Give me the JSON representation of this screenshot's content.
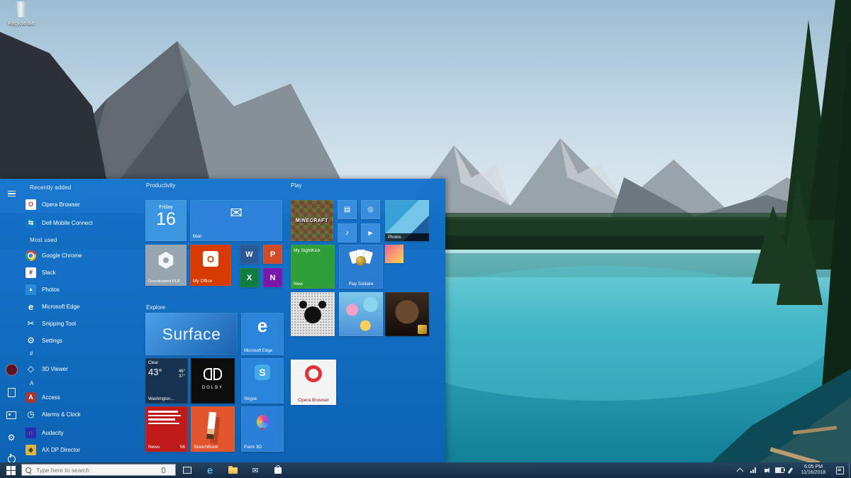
{
  "desktop": {
    "recycle_bin_label": "Recycle Bin"
  },
  "colors": {
    "accent": "#1373cc",
    "taskbar": "#1b3654",
    "lake": "#1d93a8",
    "news_red": "#c01b1b",
    "office_orange": "#d83b01"
  },
  "icons": {
    "opera": "O",
    "dell": "⇆",
    "slack": "#",
    "photos": "▲",
    "edge": "e",
    "snipping": "✂",
    "settings": "⚙",
    "viewer3d": "◇",
    "access": "A",
    "alarms": "◷",
    "audacity": "∩",
    "axdp": "◈",
    "store": "▤",
    "camera": "◎",
    "groove": "♪",
    "movies": "▶",
    "mail": "✉"
  },
  "start_menu": {
    "rail": {
      "icons": [
        "hamburger",
        "user-avatar",
        "documents",
        "pictures",
        "settings",
        "power"
      ]
    },
    "app_list": {
      "sections": [
        {
          "header": "Recently added",
          "items": [
            {
              "label": "Opera Browser"
            },
            {
              "label": "Dell Mobile Connect"
            }
          ]
        },
        {
          "header": "Most used",
          "items": [
            {
              "label": "Google Chrome"
            },
            {
              "label": "Slack"
            },
            {
              "label": "Photos"
            },
            {
              "label": "Microsoft Edge"
            },
            {
              "label": "Snipping Tool"
            },
            {
              "label": "Settings"
            }
          ]
        },
        {
          "header": "#",
          "items": [
            {
              "label": "3D Viewer"
            }
          ]
        },
        {
          "header": "A",
          "items": [
            {
              "label": "Access"
            },
            {
              "label": "Alarms & Clock"
            },
            {
              "label": "Audacity"
            },
            {
              "label": "AX DP Director"
            }
          ]
        }
      ]
    },
    "groups": [
      {
        "title": "Productivity"
      },
      {
        "title": "Explore"
      },
      {
        "title": "Play"
      }
    ],
    "tiles": {
      "calendar": {
        "weekday": "Friday",
        "day": "16"
      },
      "mail": {
        "label": "Mail"
      },
      "downloaded": {
        "label": "Downloaded PLR"
      },
      "my_office": {
        "label": "My Office"
      },
      "word": {
        "letter": "W"
      },
      "powerpoint": {
        "letter": "P"
      },
      "excel": {
        "letter": "X"
      },
      "onenote": {
        "letter": "N"
      },
      "surface": {
        "text": "Surface"
      },
      "edge": {
        "label": "Microsoft Edge"
      },
      "weather": {
        "condition": "Clear",
        "temp": "43°",
        "high": "46°",
        "low": "37°",
        "location": "Washington..."
      },
      "dolby": {
        "text": "DOLBY"
      },
      "skype": {
        "label": "Skype",
        "letter": "S"
      },
      "news": {
        "label": "News",
        "badge": "56"
      },
      "sketchbook": {
        "label": "SketchBook"
      },
      "paint3d": {
        "label": "Paint 3D"
      },
      "minecraft": {
        "text": "MINECRAFT"
      },
      "photos": {
        "label": "Photos"
      },
      "sightkick": {
        "text": "My SightKick",
        "badge": "New"
      },
      "solitaire": {
        "label": "Play Solitaire"
      },
      "opera": {
        "label": "Opera Browser"
      }
    }
  },
  "taskbar": {
    "search": {
      "placeholder": "Type here to search"
    },
    "icons": [
      "start",
      "task-view",
      "microsoft-edge",
      "file-explorer",
      "mail",
      "microsoft-store"
    ],
    "tray_icons": [
      "chevron-up",
      "network",
      "volume",
      "battery",
      "pen",
      "action-center",
      "show-desktop"
    ],
    "tray": {
      "time": "6:05 PM",
      "date": "11/16/2018"
    }
  }
}
